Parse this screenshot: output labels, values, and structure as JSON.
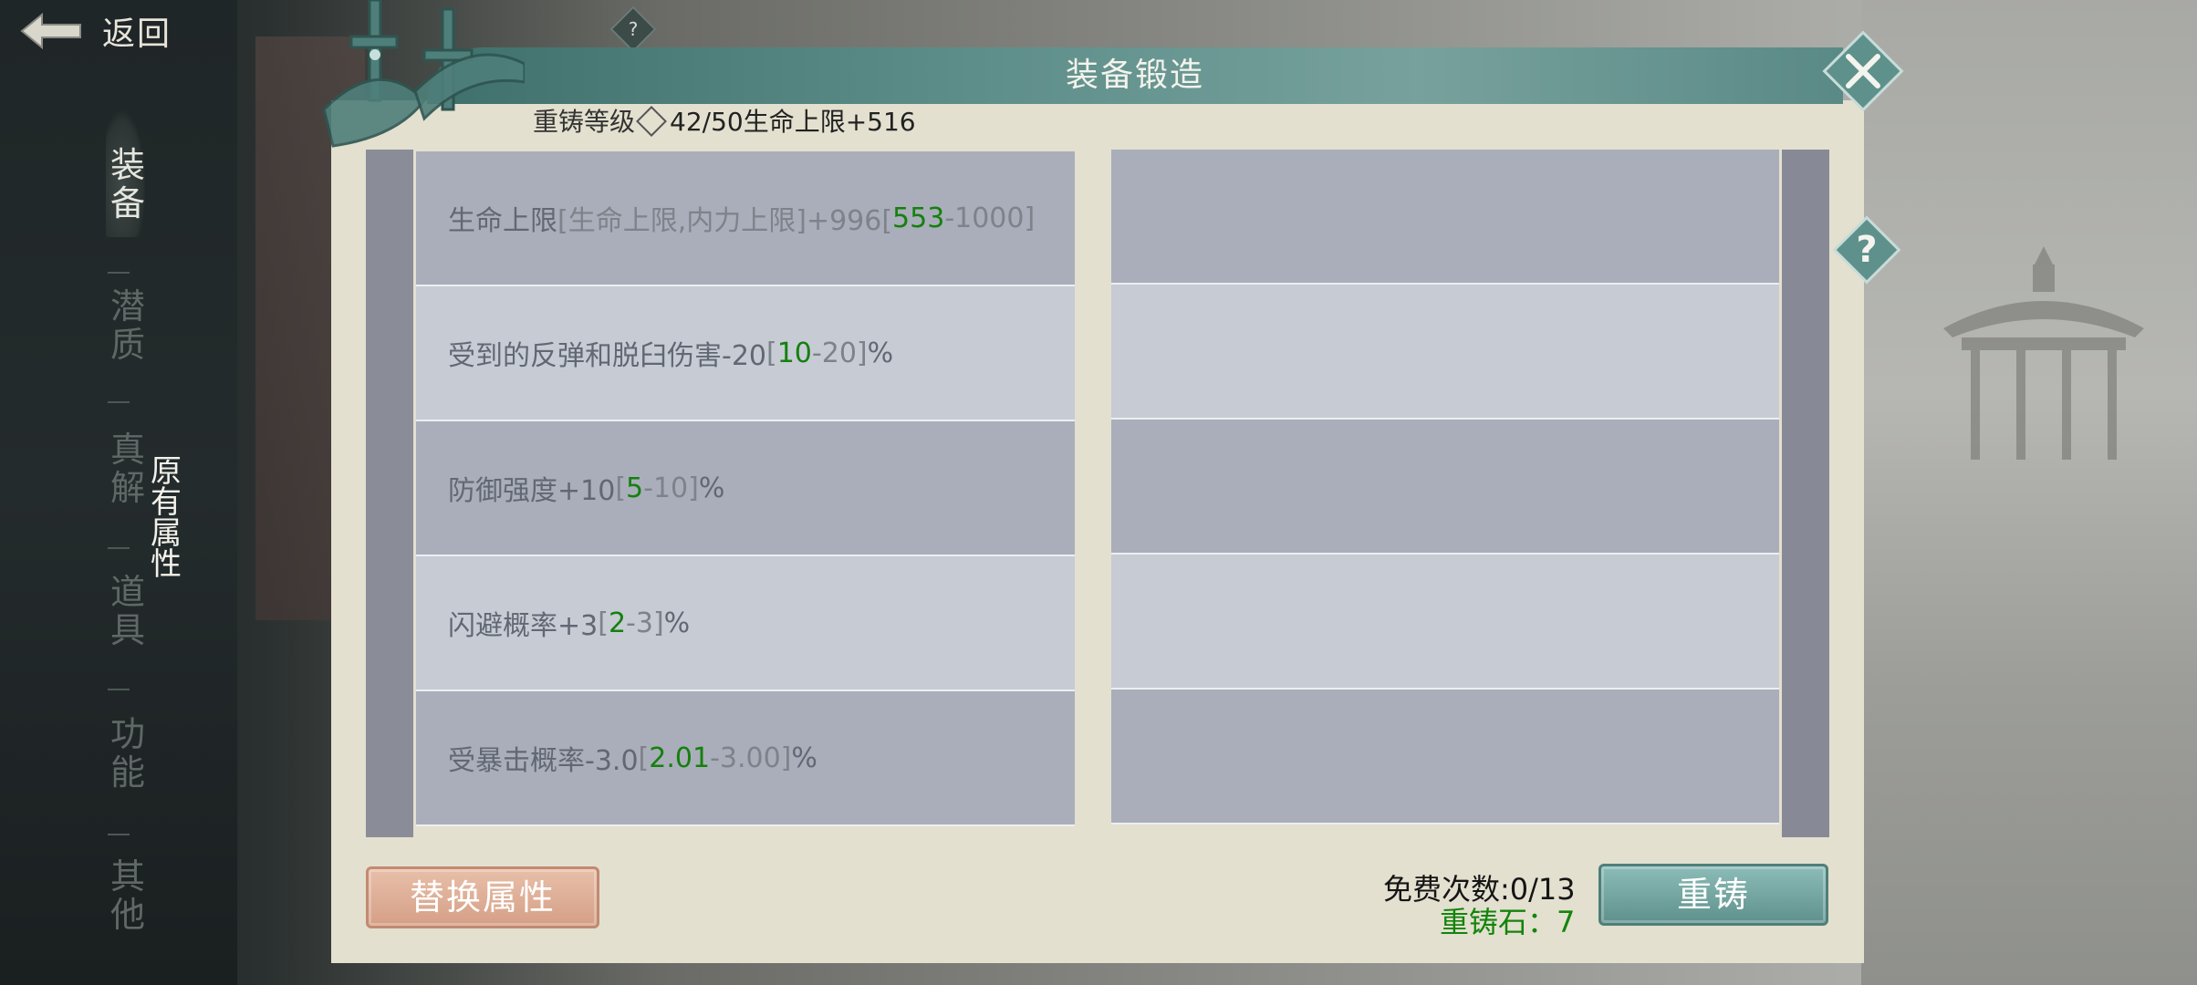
{
  "nav": {
    "back_label": "返回",
    "help_small": "?"
  },
  "side_tabs": [
    {
      "label": "装\n备",
      "active": true
    },
    {
      "label": "潜\n质",
      "active": false
    },
    {
      "label": "真\n解",
      "active": false
    },
    {
      "label": "道\n具",
      "active": false
    },
    {
      "label": "功\n能",
      "active": false
    },
    {
      "label": "其\n他",
      "active": false
    }
  ],
  "sub_tab": {
    "label": "原\n有\n属\n性"
  },
  "panel": {
    "title": "装备锻造",
    "recast_level": {
      "label": "重铸等级",
      "value": "42/50生命上限+516"
    },
    "help_label": "?"
  },
  "attributes": [
    {
      "text": "生命上限",
      "bracket_open": "[生命上限,内力上限]+996[",
      "roll": "553",
      "range_rest": "-1000]",
      "suffix": ""
    },
    {
      "text": "受到的反弹和脱臼伤害-20",
      "bracket_open": "[",
      "roll": "10",
      "range_rest": "-20]",
      "suffix": "%"
    },
    {
      "text": "防御强度+10",
      "bracket_open": "[",
      "roll": "5",
      "range_rest": "-10]",
      "suffix": "%"
    },
    {
      "text": "闪避概率+3",
      "bracket_open": "[",
      "roll": "2",
      "range_rest": "-3]",
      "suffix": "%"
    },
    {
      "text": "受暴击概率-3.0",
      "bracket_open": "[",
      "roll": "2.01",
      "range_rest": "-3.00]",
      "suffix": "%"
    }
  ],
  "footer": {
    "replace_label": "替换属性",
    "free_count": "免费次数:0/13",
    "stone": "重铸石：7",
    "recast_label": "重铸"
  },
  "colors": {
    "accent_teal": "#5f918c",
    "roll_green": "#15800e",
    "panel_bg": "#e3e0cf",
    "replace_btn": "#d59f86"
  },
  "icons": [
    "back-arrow-icon",
    "question-icon",
    "close-icon",
    "sword-decoration-icon"
  ]
}
